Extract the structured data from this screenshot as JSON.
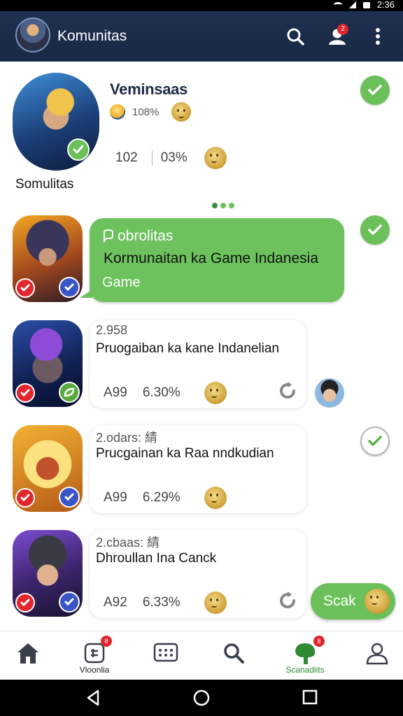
{
  "status_bar": {
    "time": "2:36"
  },
  "app_bar": {
    "title": "Komunitas",
    "notification_count": "2"
  },
  "profile": {
    "name": "Veminsaas",
    "meta_value": "108%",
    "stat_1": "102",
    "stat_2": "03%",
    "caption": "Somulitas"
  },
  "featured": {
    "tag": "obrolitas",
    "title": "Kormunaitan ka Game Indanesia",
    "subtitle": "Game"
  },
  "items": [
    {
      "count": "2.958",
      "title": "Pruogaiban ka kane Indanelian",
      "stat_1": "A99",
      "stat_2": "6.30%"
    },
    {
      "count": "2.odars: 綪",
      "title": "Prucgainan ka Raa nndkudian",
      "stat_1": "A99",
      "stat_2": "6.29%"
    },
    {
      "count": "2.cbaas: 綪",
      "title": "Dhroullan Ina Canck",
      "stat_1": "A92",
      "stat_2": "6.33%"
    }
  ],
  "fab": {
    "label": "Scak"
  },
  "bottom_nav": {
    "items": [
      {
        "icon": "home-icon",
        "label": ""
      },
      {
        "icon": "calculator-icon",
        "label": "Vloonlia",
        "badge": "8"
      },
      {
        "icon": "chat-icon",
        "label": ""
      },
      {
        "icon": "search-icon",
        "label": ""
      },
      {
        "icon": "tree-icon",
        "label": "Scanadiits",
        "badge": "8"
      },
      {
        "icon": "profile-icon",
        "label": ""
      }
    ]
  },
  "colors": {
    "app_bar": "#1f3150",
    "accent_green": "#6cc05a",
    "badge_red": "#e0242c"
  }
}
